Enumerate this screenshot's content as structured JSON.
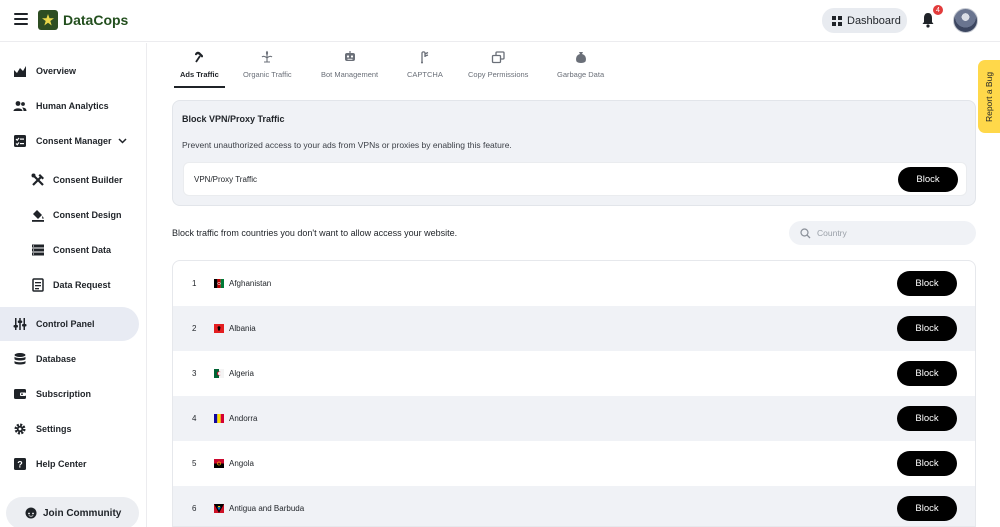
{
  "header": {
    "app_name": "DataCops",
    "dashboard_label": "Dashboard",
    "notification_count": "4"
  },
  "sidebar": {
    "items": [
      {
        "label": "Overview",
        "icon": "chart-icon"
      },
      {
        "label": "Human Analytics",
        "icon": "people-icon"
      },
      {
        "label": "Consent Manager",
        "icon": "checklist-icon"
      },
      {
        "label": "Consent Builder",
        "icon": "tools-icon"
      },
      {
        "label": "Consent Design",
        "icon": "paint-bucket-icon"
      },
      {
        "label": "Consent Data",
        "icon": "list-icon"
      },
      {
        "label": "Data Request",
        "icon": "document-icon"
      },
      {
        "label": "Control Panel",
        "icon": "sliders-icon",
        "active": true
      },
      {
        "label": "Database",
        "icon": "database-icon"
      },
      {
        "label": "Subscription",
        "icon": "wallet-icon"
      },
      {
        "label": "Settings",
        "icon": "gear-icon"
      },
      {
        "label": "Help Center",
        "icon": "help-icon"
      }
    ],
    "join_label": "Join Community"
  },
  "tabs": [
    {
      "label": "Ads Traffic",
      "active": true
    },
    {
      "label": "Organic Traffic"
    },
    {
      "label": "Bot Management"
    },
    {
      "label": "CAPTCHA"
    },
    {
      "label": "Copy Permissions"
    },
    {
      "label": "Garbage Data"
    }
  ],
  "vpn": {
    "title": "Block VPN/Proxy Traffic",
    "description": "Prevent unauthorized access to your ads from VPNs or proxies by enabling this feature.",
    "row_label": "VPN/Proxy Traffic",
    "button_label": "Block"
  },
  "countries": {
    "intro": "Block traffic from countries you don't want to allow access your website.",
    "search_placeholder": "Country",
    "rows": [
      {
        "num": "1",
        "name": "Afghanistan",
        "button": "Block"
      },
      {
        "num": "2",
        "name": "Albania",
        "button": "Block"
      },
      {
        "num": "3",
        "name": "Algeria",
        "button": "Block"
      },
      {
        "num": "4",
        "name": "Andorra",
        "button": "Block"
      },
      {
        "num": "5",
        "name": "Angola",
        "button": "Block"
      },
      {
        "num": "6",
        "name": "Antigua and Barbuda",
        "button": "Block"
      }
    ]
  },
  "report_bug_label": "Report a Bug",
  "colors": {
    "brand": "#234f1e",
    "active_bg": "#e8ebf3",
    "button": "#000000",
    "report_tab": "#ffd84a",
    "badge": "#e23b3b"
  }
}
